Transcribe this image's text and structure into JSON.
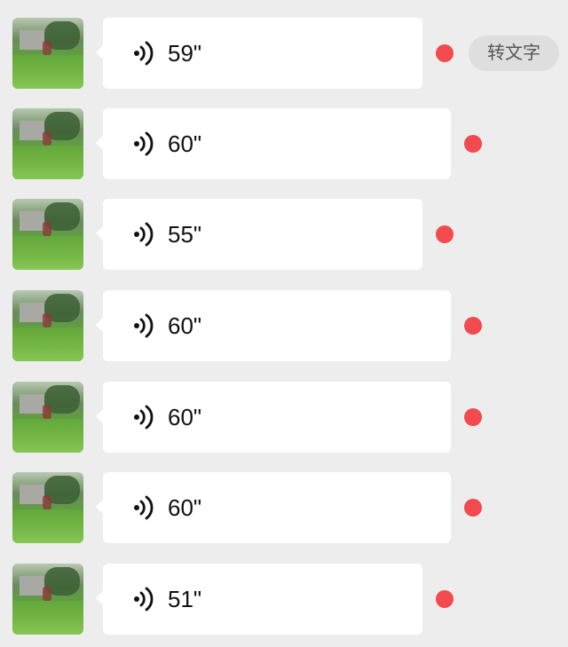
{
  "colors": {
    "background": "#ededed",
    "bubble": "#ffffff",
    "unread_dot": "#f24a4e",
    "button_bg": "#dedede"
  },
  "messages": [
    {
      "duration": "59\"",
      "unread": true,
      "show_to_text": true
    },
    {
      "duration": "60\"",
      "unread": true
    },
    {
      "duration": "55\"",
      "unread": true
    },
    {
      "duration": "60\"",
      "unread": true
    },
    {
      "duration": "60\"",
      "unread": true
    },
    {
      "duration": "60\"",
      "unread": true
    },
    {
      "duration": "51\"",
      "unread": true
    }
  ],
  "to_text_label": "转文字",
  "icons": {
    "voice": "voice-wave-icon",
    "avatar": "avatar-image"
  }
}
